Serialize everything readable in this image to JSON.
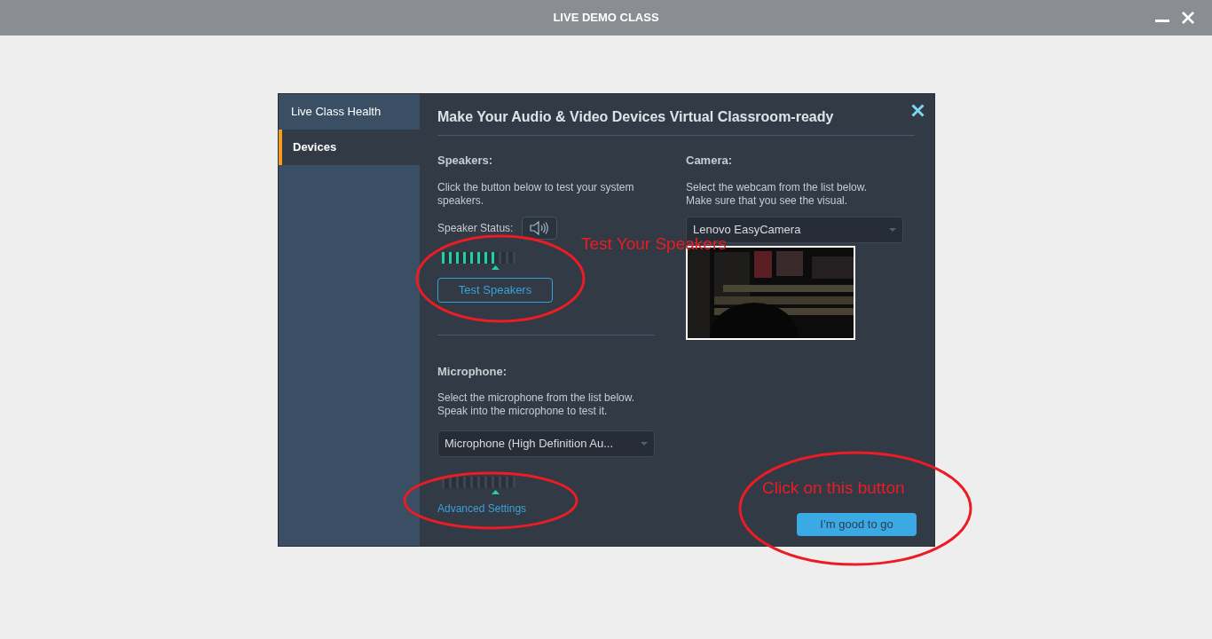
{
  "window": {
    "title": "LIVE DEMO CLASS"
  },
  "sidebar": {
    "items": [
      {
        "label": "Live Class Health",
        "selected": false
      },
      {
        "label": "Devices",
        "selected": true
      }
    ]
  },
  "dialog": {
    "title": "Make Your Audio & Video Devices Virtual Classroom-ready",
    "speakers": {
      "heading": "Speakers:",
      "description": "Click the button below to test your system speakers.",
      "status_label": "Speaker Status:",
      "meter": {
        "level": 0.73
      },
      "button": "Test Speakers"
    },
    "microphone": {
      "heading": "Microphone:",
      "description": "Select the microphone from the list below. Speak into the microphone to test it.",
      "device": "Microphone (High Definition Au...",
      "meter": {
        "level": 0
      },
      "link": "Advanced Settings"
    },
    "camera": {
      "heading": "Camera:",
      "description": "Select the webcam from the list below. Make sure that you see the visual.",
      "device": "Lenovo EasyCamera"
    },
    "confirm_button": "I’m good to go"
  },
  "annotations": [
    {
      "text": "Test Your Speakers"
    },
    {
      "text": "Click on this button"
    }
  ]
}
